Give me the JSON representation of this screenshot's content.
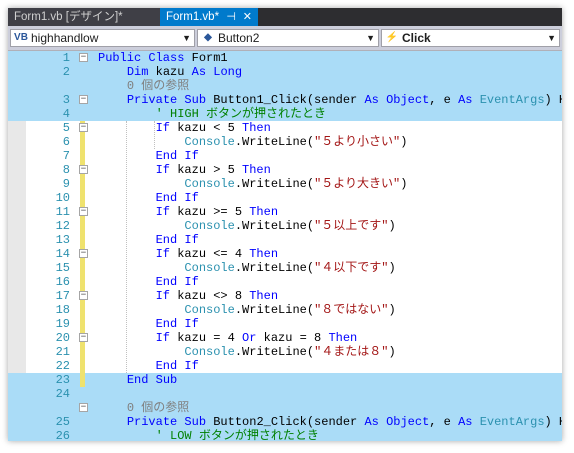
{
  "tabs": [
    {
      "label": "Form1.vb [デザイン]*",
      "active": false
    },
    {
      "label": "Form1.vb*",
      "active": true,
      "pin": "⊣",
      "close": "✕"
    }
  ],
  "navbar": {
    "scope": "highhandlow",
    "object": "Button2",
    "event": "Click"
  },
  "lines": [
    {
      "n": "1",
      "hl": true,
      "tokens": [
        [
          "kw",
          "Public Class "
        ],
        [
          "",
          "Form1"
        ]
      ]
    },
    {
      "n": "2",
      "hl": true,
      "tokens": [
        [
          "",
          "    "
        ],
        [
          "kw",
          "Dim "
        ],
        [
          "",
          "kazu "
        ],
        [
          "kw",
          "As Long"
        ]
      ]
    },
    {
      "n": "",
      "hl": true,
      "tokens": [
        [
          "",
          "    "
        ],
        [
          "ref",
          "0 個の参照"
        ]
      ]
    },
    {
      "n": "3",
      "hl": true,
      "tokens": [
        [
          "",
          "    "
        ],
        [
          "kw",
          "Private Sub "
        ],
        [
          "",
          "Button1_Click(sender "
        ],
        [
          "kw",
          "As Object"
        ],
        [
          "",
          ", e "
        ],
        [
          "kw",
          "As "
        ],
        [
          "ty",
          "EventArgs"
        ],
        [
          "",
          ") Ha"
        ]
      ]
    },
    {
      "n": "4",
      "hl": true,
      "tokens": [
        [
          "",
          "        "
        ],
        [
          "cm",
          "' HIGH ボタンが押されたとき"
        ]
      ]
    },
    {
      "n": "5",
      "hl": false,
      "tokens": [
        [
          "",
          "        "
        ],
        [
          "kw",
          "If "
        ],
        [
          "",
          "kazu < 5 "
        ],
        [
          "kw",
          "Then"
        ]
      ]
    },
    {
      "n": "6",
      "hl": false,
      "tokens": [
        [
          "",
          "            "
        ],
        [
          "ty",
          "Console"
        ],
        [
          "",
          ".WriteLine("
        ],
        [
          "st",
          "\"５より小さい\""
        ],
        [
          "",
          ")"
        ]
      ]
    },
    {
      "n": "7",
      "hl": false,
      "tokens": [
        [
          "",
          "        "
        ],
        [
          "kw",
          "End If"
        ]
      ]
    },
    {
      "n": "8",
      "hl": false,
      "tokens": [
        [
          "",
          "        "
        ],
        [
          "kw",
          "If "
        ],
        [
          "",
          "kazu > 5 "
        ],
        [
          "kw",
          "Then"
        ]
      ]
    },
    {
      "n": "9",
      "hl": false,
      "tokens": [
        [
          "",
          "            "
        ],
        [
          "ty",
          "Console"
        ],
        [
          "",
          ".WriteLine("
        ],
        [
          "st",
          "\"５より大きい\""
        ],
        [
          "",
          ")"
        ]
      ]
    },
    {
      "n": "10",
      "hl": false,
      "tokens": [
        [
          "",
          "        "
        ],
        [
          "kw",
          "End If"
        ]
      ]
    },
    {
      "n": "11",
      "hl": false,
      "tokens": [
        [
          "",
          "        "
        ],
        [
          "kw",
          "If "
        ],
        [
          "",
          "kazu >= 5 "
        ],
        [
          "kw",
          "Then"
        ]
      ]
    },
    {
      "n": "12",
      "hl": false,
      "tokens": [
        [
          "",
          "            "
        ],
        [
          "ty",
          "Console"
        ],
        [
          "",
          ".WriteLine("
        ],
        [
          "st",
          "\"５以上です\""
        ],
        [
          "",
          ")"
        ]
      ]
    },
    {
      "n": "13",
      "hl": false,
      "tokens": [
        [
          "",
          "        "
        ],
        [
          "kw",
          "End If"
        ]
      ]
    },
    {
      "n": "14",
      "hl": false,
      "tokens": [
        [
          "",
          "        "
        ],
        [
          "kw",
          "If "
        ],
        [
          "",
          "kazu <= 4 "
        ],
        [
          "kw",
          "Then"
        ]
      ]
    },
    {
      "n": "15",
      "hl": false,
      "tokens": [
        [
          "",
          "            "
        ],
        [
          "ty",
          "Console"
        ],
        [
          "",
          ".WriteLine("
        ],
        [
          "st",
          "\"４以下です\""
        ],
        [
          "",
          ")"
        ]
      ]
    },
    {
      "n": "16",
      "hl": false,
      "tokens": [
        [
          "",
          "        "
        ],
        [
          "kw",
          "End If"
        ]
      ]
    },
    {
      "n": "17",
      "hl": false,
      "tokens": [
        [
          "",
          "        "
        ],
        [
          "kw",
          "If "
        ],
        [
          "",
          "kazu <> 8 "
        ],
        [
          "kw",
          "Then"
        ]
      ]
    },
    {
      "n": "18",
      "hl": false,
      "tokens": [
        [
          "",
          "            "
        ],
        [
          "ty",
          "Console"
        ],
        [
          "",
          ".WriteLine("
        ],
        [
          "st",
          "\"８ではない\""
        ],
        [
          "",
          ")"
        ]
      ]
    },
    {
      "n": "19",
      "hl": false,
      "tokens": [
        [
          "",
          "        "
        ],
        [
          "kw",
          "End If"
        ]
      ]
    },
    {
      "n": "20",
      "hl": false,
      "tokens": [
        [
          "",
          "        "
        ],
        [
          "kw",
          "If "
        ],
        [
          "",
          "kazu = 4 "
        ],
        [
          "kw",
          "Or "
        ],
        [
          "",
          "kazu = 8 "
        ],
        [
          "kw",
          "Then"
        ]
      ]
    },
    {
      "n": "21",
      "hl": false,
      "tokens": [
        [
          "",
          "            "
        ],
        [
          "ty",
          "Console"
        ],
        [
          "",
          ".WriteLine("
        ],
        [
          "st",
          "\"４または８\""
        ],
        [
          "",
          ")"
        ]
      ]
    },
    {
      "n": "22",
      "hl": false,
      "tokens": [
        [
          "",
          "        "
        ],
        [
          "kw",
          "End If"
        ]
      ]
    },
    {
      "n": "23",
      "hl": true,
      "tokens": [
        [
          "",
          "    "
        ],
        [
          "kw",
          "End Sub"
        ]
      ]
    },
    {
      "n": "24",
      "hl": true,
      "tokens": []
    },
    {
      "n": "",
      "hl": true,
      "tokens": [
        [
          "",
          "    "
        ],
        [
          "ref",
          "0 個の参照"
        ]
      ]
    },
    {
      "n": "25",
      "hl": true,
      "tokens": [
        [
          "",
          "    "
        ],
        [
          "kw",
          "Private Sub "
        ],
        [
          "",
          "Button2_Click(sender "
        ],
        [
          "kw",
          "As Object"
        ],
        [
          "",
          ", e "
        ],
        [
          "kw",
          "As "
        ],
        [
          "ty",
          "EventArgs"
        ],
        [
          "",
          ") Ha"
        ]
      ]
    },
    {
      "n": "26",
      "hl": true,
      "tokens": [
        [
          "",
          "        "
        ],
        [
          "cm",
          "' LOW ボタンが押されたとき"
        ]
      ]
    }
  ]
}
